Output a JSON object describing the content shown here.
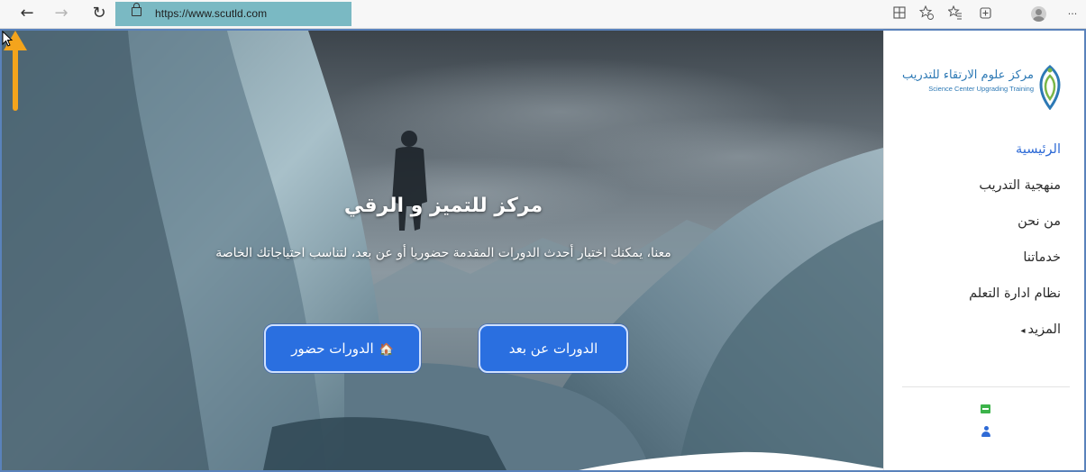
{
  "browser": {
    "url": "https://www.scutld.com",
    "back_icon": "←",
    "forward_icon": "→",
    "refresh_icon": "↻",
    "toolbar_icons": [
      "reader-view-icon",
      "favorite-add-icon",
      "favorites-icon",
      "collections-icon",
      "profile-icon",
      "more-icon"
    ],
    "more_label": "···"
  },
  "hero": {
    "title": "مركز للتميز و الرقي",
    "subtitle": "معنا، يمكنك اختيار أحدث الدورات المقدمة حضوريا أو عن بعد، لتناسب احتياجاتك الخاصة",
    "button_onsite": "الدورات حضور",
    "button_onsite_icon": "🏠",
    "button_remote": "الدورات عن بعد"
  },
  "sidebar": {
    "logo_ar": "مركز علوم الارتقاء للتدريب",
    "logo_en": "Science Center Upgrading Training",
    "menu": [
      {
        "label": "الرئيسية",
        "active": true
      },
      {
        "label": "منهجية التدريب",
        "active": false
      },
      {
        "label": "من نحن",
        "active": false
      },
      {
        "label": "خدماتنا",
        "active": false
      },
      {
        "label": "نظام ادارة التعلم",
        "active": false
      },
      {
        "label": "المزيد",
        "active": false,
        "caret": "◂"
      }
    ]
  },
  "colors": {
    "accent": "#2f6bd6",
    "button": "#2a6fe0",
    "annotation_arrow": "#f4a41c",
    "address_highlight": "#7ab9c3"
  }
}
